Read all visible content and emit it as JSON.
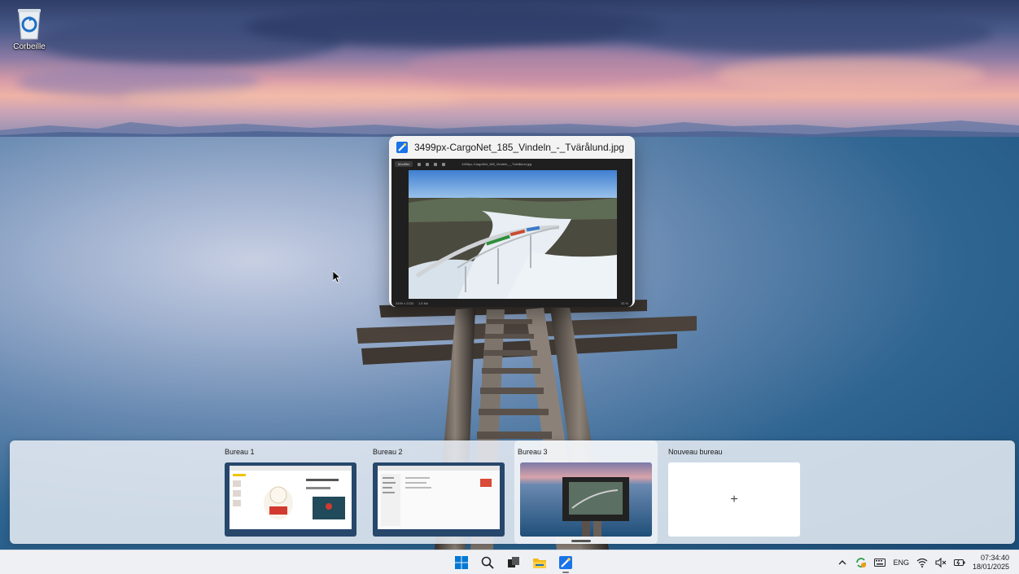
{
  "desktop": {
    "recycle_bin_label": "Corbeille"
  },
  "task_view": {
    "window": {
      "title": "3499px-CargoNet_185_Vindeln_-_Tvärålund.jpg",
      "app_toolbar_label": "Modifier",
      "app_file_name": "3499px-CargoNet_185_Vindeln_-_Tvärålund.jpg",
      "status_dims": "3499 x 2333",
      "status_size": "1.8 Mo",
      "status_zoom": "33 %"
    },
    "desktops": [
      {
        "name": "Bureau 1"
      },
      {
        "name": "Bureau 2"
      },
      {
        "name": "Bureau 3",
        "active": true
      },
      {
        "name": "Nouveau bureau",
        "plus": "+"
      }
    ]
  },
  "taskbar": {
    "apps": [
      {
        "icon": "windows-start-icon"
      },
      {
        "icon": "search-icon"
      },
      {
        "icon": "task-view-icon"
      },
      {
        "icon": "file-explorer-icon"
      },
      {
        "icon": "photos-app-icon",
        "running": true
      }
    ],
    "tray": {
      "language": "ENG",
      "time": "07:34:40",
      "date": "18/01/2025"
    }
  },
  "colors": {
    "accent": "#0067c0",
    "strip_bg": "#e9eef4",
    "taskbar_bg": "#eef0f4"
  }
}
